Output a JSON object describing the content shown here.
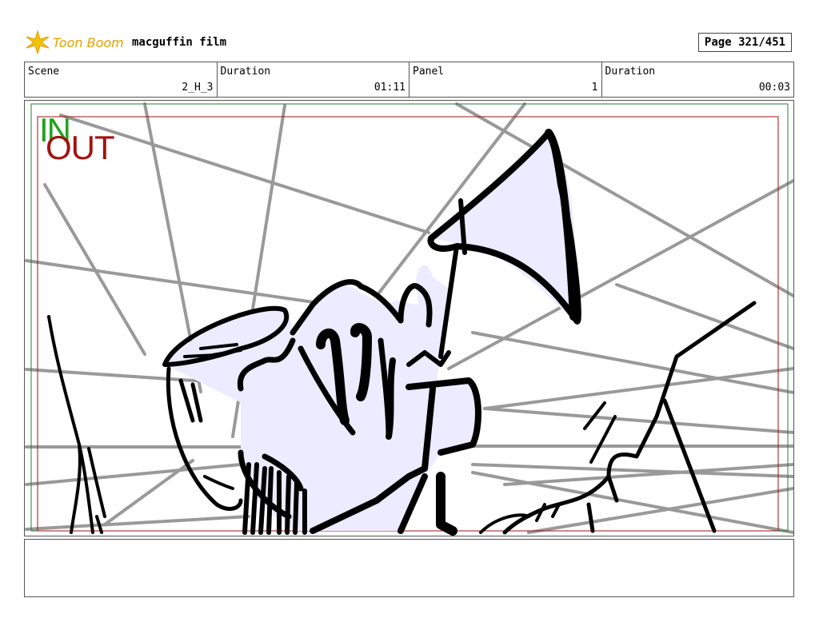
{
  "header": {
    "logo_text": "Toon Boom",
    "project_title": "macguffin film",
    "page_label": "Page 321/451"
  },
  "info": [
    {
      "label": "Scene",
      "value": "2_H_3"
    },
    {
      "label": "Duration",
      "value": "01:11"
    },
    {
      "label": "Panel",
      "value": "1"
    },
    {
      "label": "Duration",
      "value": "00:03"
    }
  ],
  "panel": {
    "in_label": "IN",
    "out_label": "OUT",
    "colors": {
      "safe_frame": "#2e7d32",
      "camera_frame": "#a31212",
      "guide_lines": "#999999",
      "fill": "#ecebff",
      "ink": "#000000"
    }
  },
  "notes": {
    "text": ""
  }
}
